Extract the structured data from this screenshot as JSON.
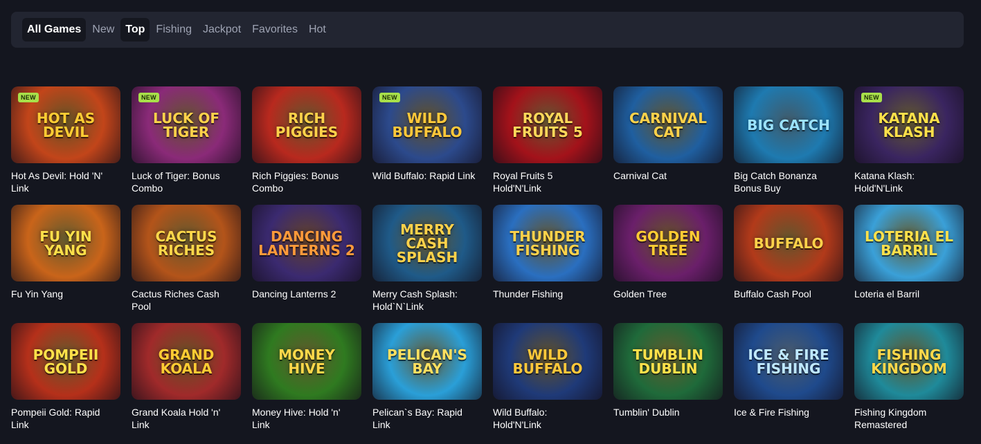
{
  "tabs": [
    {
      "label": "All Games",
      "active": true
    },
    {
      "label": "New",
      "active": false
    },
    {
      "label": "Top",
      "active": true
    },
    {
      "label": "Fishing",
      "active": false
    },
    {
      "label": "Jackpot",
      "active": false
    },
    {
      "label": "Favorites",
      "active": false
    },
    {
      "label": "Hot",
      "active": false
    }
  ],
  "badge_label": "NEW",
  "games": [
    {
      "title": "Hot As Devil: Hold 'N' Link",
      "art": "HOT AS DEVIL",
      "badge": true,
      "bg": "#c2451a",
      "accent": "#ffcc33"
    },
    {
      "title": "Luck of Tiger: Bonus Combo",
      "art": "LUCK OF TIGER",
      "badge": true,
      "bg": "#8a2a78",
      "accent": "#ffd24a"
    },
    {
      "title": "Rich Piggies: Bonus Combo",
      "art": "RICH PIGGIES",
      "badge": false,
      "bg": "#b8291e",
      "accent": "#ffd24a"
    },
    {
      "title": "Wild Buffalo: Rapid Link",
      "art": "WILD BUFFALO",
      "badge": true,
      "bg": "#2c4a8c",
      "accent": "#ffc83a"
    },
    {
      "title": "Royal Fruits 5 Hold'N'Link",
      "art": "ROYAL FRUITS 5",
      "badge": false,
      "bg": "#a3121a",
      "accent": "#ffd85a"
    },
    {
      "title": "Carnival Cat",
      "art": "CARNIVAL CAT",
      "badge": false,
      "bg": "#1f5fa0",
      "accent": "#ffd24a"
    },
    {
      "title": "Big Catch Bonanza Bonus Buy",
      "art": "BIG CATCH",
      "badge": false,
      "bg": "#1e7ab0",
      "accent": "#9be3ff"
    },
    {
      "title": "Katana Klash: Hold'N'Link",
      "art": "KATANA KLASH",
      "badge": true,
      "bg": "#3a2560",
      "accent": "#ffe14a"
    },
    {
      "title": "Fu Yin Yang",
      "art": "FU YIN YANG",
      "badge": false,
      "bg": "#c9641a",
      "accent": "#ffe04a"
    },
    {
      "title": "Cactus Riches Cash Pool",
      "art": "CACTUS RICHES",
      "badge": false,
      "bg": "#b3541a",
      "accent": "#ffd84a"
    },
    {
      "title": "Dancing Lanterns 2",
      "art": "DANCING LANTERNS 2",
      "badge": false,
      "bg": "#3b2a70",
      "accent": "#ff9a3a"
    },
    {
      "title": "Merry Cash Splash: Hold`N`Link",
      "art": "MERRY CASH SPLASH",
      "badge": false,
      "bg": "#1f5a88",
      "accent": "#ffd24a"
    },
    {
      "title": "Thunder Fishing",
      "art": "THUNDER FISHING",
      "badge": false,
      "bg": "#2a6fc0",
      "accent": "#ffd24a"
    },
    {
      "title": "Golden Tree",
      "art": "GOLDEN TREE",
      "badge": false,
      "bg": "#6a1f6a",
      "accent": "#ffcc33"
    },
    {
      "title": "Buffalo Cash Pool",
      "art": "BUFFALO",
      "badge": false,
      "bg": "#b23a1a",
      "accent": "#ffd24a"
    },
    {
      "title": "Loteria el Barril",
      "art": "LOTERIA EL BARRIL",
      "badge": false,
      "bg": "#3aa0d8",
      "accent": "#ffe14a"
    },
    {
      "title": "Pompeii Gold: Rapid Link",
      "art": "POMPEII GOLD",
      "badge": false,
      "bg": "#b5301a",
      "accent": "#ffe14a"
    },
    {
      "title": "Grand Koala Hold 'n' Link",
      "art": "GRAND KOALA",
      "badge": false,
      "bg": "#a02a2a",
      "accent": "#ffcc33"
    },
    {
      "title": "Money Hive: Hold 'n' Link",
      "art": "MONEY HIVE",
      "badge": false,
      "bg": "#2f7a20",
      "accent": "#ffd84a"
    },
    {
      "title": "Pelican`s Bay: Rapid Link",
      "art": "PELICAN'S BAY",
      "badge": false,
      "bg": "#2a9fd8",
      "accent": "#ffe060"
    },
    {
      "title": "Wild Buffalo: Hold'N'Link",
      "art": "WILD BUFFALO",
      "badge": false,
      "bg": "#1f3a78",
      "accent": "#ffc83a"
    },
    {
      "title": "Tumblin' Dublin",
      "art": "TUMBLIN DUBLIN",
      "badge": false,
      "bg": "#1f6a3a",
      "accent": "#ffe14a"
    },
    {
      "title": "Ice & Fire Fishing",
      "art": "ICE & FIRE FISHING",
      "badge": false,
      "bg": "#1f4a8c",
      "accent": "#bfe8ff"
    },
    {
      "title": "Fishing Kingdom Remastered",
      "art": "FISHING KINGDOM",
      "badge": false,
      "bg": "#1f8a9a",
      "accent": "#ffd84a"
    }
  ]
}
